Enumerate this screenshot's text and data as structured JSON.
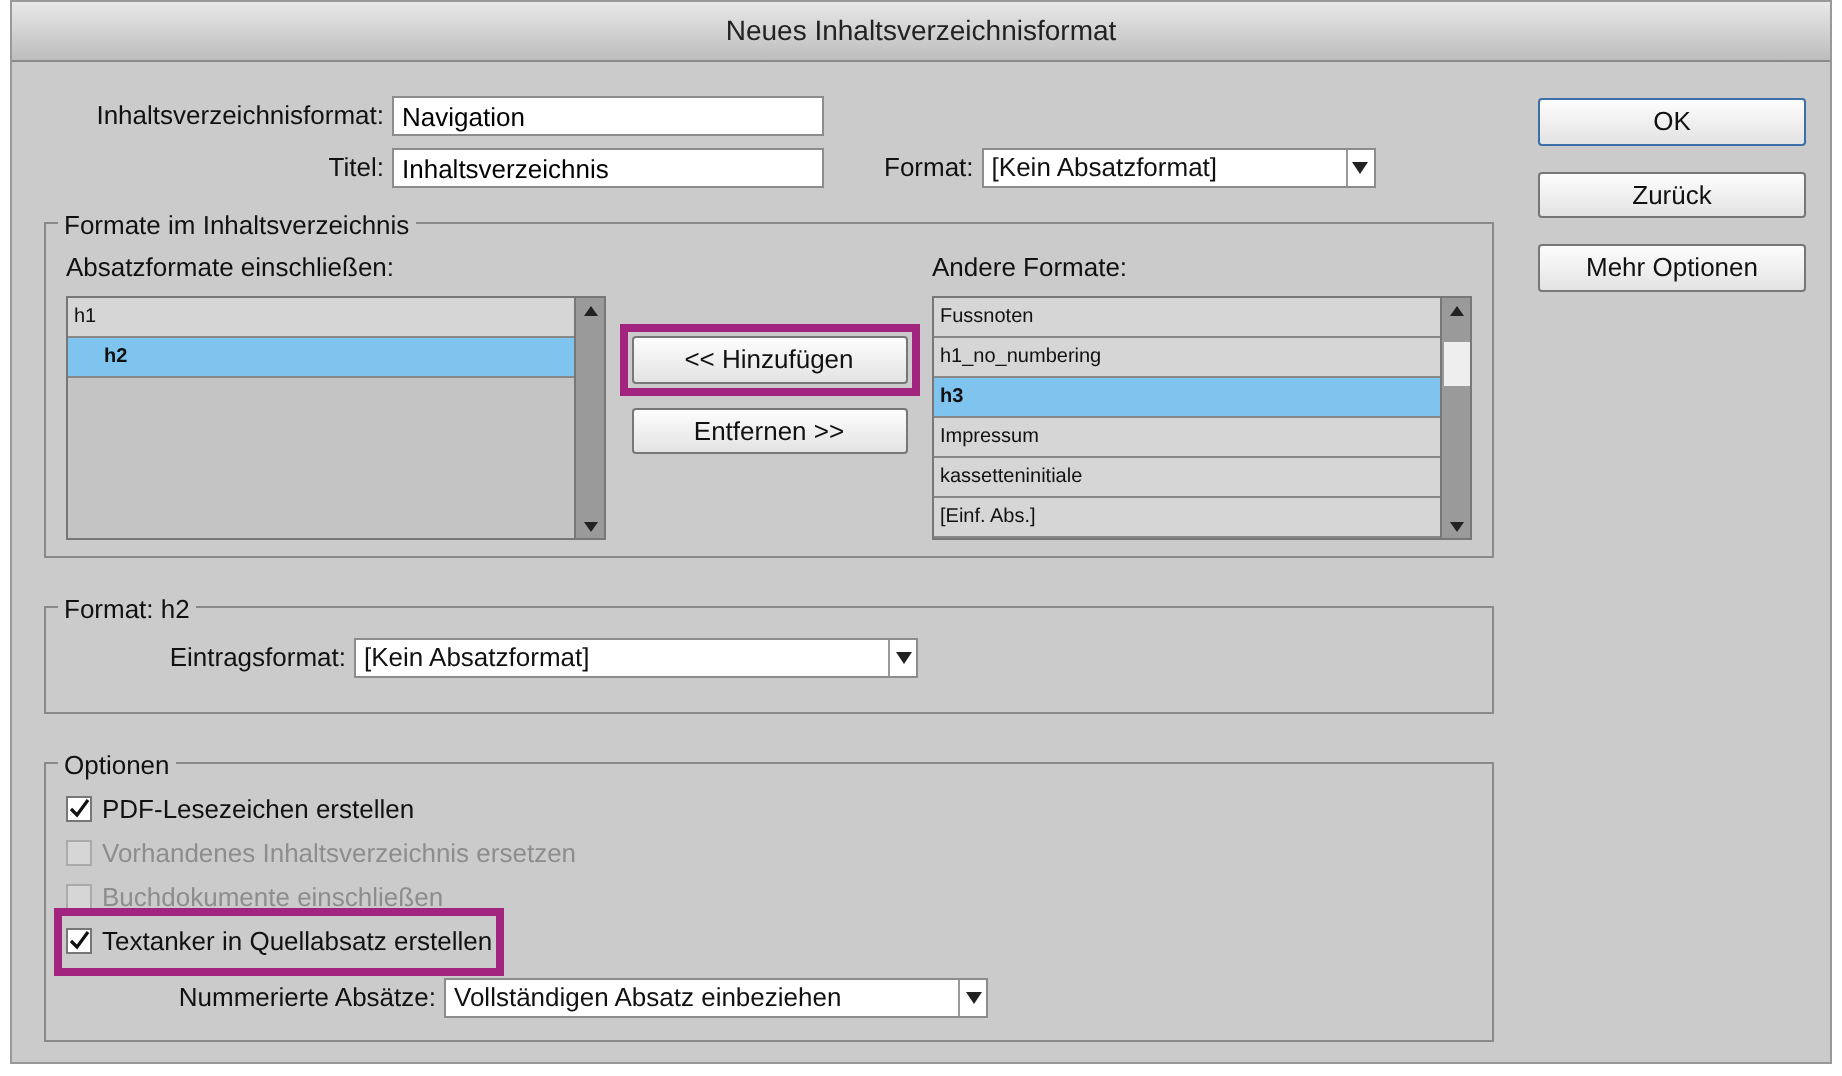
{
  "window": {
    "title": "Neues Inhaltsverzeichnisformat"
  },
  "toc_format": {
    "label": "Inhaltsverzeichnisformat:",
    "value": "Navigation"
  },
  "title_field": {
    "label": "Titel:",
    "value": "Inhaltsverzeichnis"
  },
  "format_select": {
    "label": "Format:",
    "value": "[Kein Absatzformat]"
  },
  "formats_group": {
    "legend": "Formate im Inhaltsverzeichnis",
    "included": {
      "label": "Absatzformate einschließen:",
      "items": [
        {
          "label": "h1",
          "selected": false,
          "children": [
            {
              "label": "h2",
              "selected": true
            }
          ]
        }
      ]
    },
    "buttons": [
      {
        "label": "<< Hinzufügen",
        "highlighted": true
      },
      {
        "label": "Entfernen >>",
        "highlighted": false
      }
    ],
    "other": {
      "label": "Andere Formate:",
      "items": [
        {
          "label": "Fussnoten",
          "selected": false
        },
        {
          "label": "h1_no_numbering",
          "selected": false
        },
        {
          "label": "h3",
          "selected": true
        },
        {
          "label": "Impressum",
          "selected": false
        },
        {
          "label": "kassetteninitiale",
          "selected": false
        },
        {
          "label": "[Einf. Abs.]",
          "selected": false
        }
      ]
    }
  },
  "style_group": {
    "legend": "Format: h2",
    "entry_label": "Eintragsformat:",
    "entry_value": "[Kein Absatzformat]"
  },
  "options_group": {
    "legend": "Optionen",
    "options": [
      {
        "label": "PDF-Lesezeichen erstellen",
        "checked": true,
        "disabled": false,
        "highlighted": false
      },
      {
        "label": "Vorhandenes Inhaltsverzeichnis ersetzen",
        "checked": false,
        "disabled": true,
        "highlighted": false
      },
      {
        "label": "Buchdokumente einschließen",
        "checked": false,
        "disabled": true,
        "highlighted": false
      },
      {
        "label": "Textanker in Quellabsatz erstellen",
        "checked": true,
        "disabled": false,
        "highlighted": true
      }
    ],
    "numbered_label": "Nummerierte Absätze:",
    "numbered_value": "Vollständigen Absatz einbeziehen"
  },
  "side_buttons": [
    {
      "label": "OK",
      "default": true
    },
    {
      "label": "Zurück",
      "default": false
    },
    {
      "label": "Mehr Optionen",
      "default": false
    }
  ]
}
